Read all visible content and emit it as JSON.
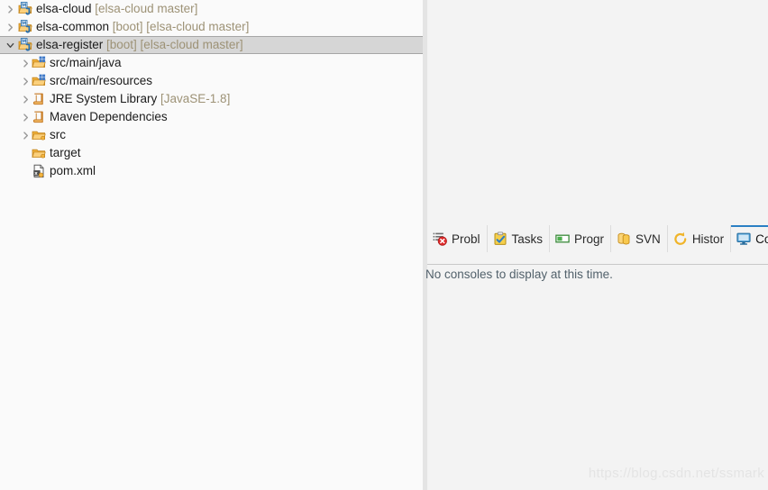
{
  "explorer": {
    "rows": [
      {
        "label": "elsa-cloud",
        "decoration": " [elsa-cloud master]",
        "icon": "maven-project-folder-icon",
        "level": 0,
        "twisty": "collapsed",
        "selected": false,
        "name": "tree-item-elsa-cloud"
      },
      {
        "label": "elsa-common",
        "decoration": " [boot] [elsa-cloud master]",
        "icon": "maven-project-folder-icon",
        "level": 0,
        "twisty": "collapsed",
        "selected": false,
        "name": "tree-item-elsa-common"
      },
      {
        "label": "elsa-register",
        "decoration": " [boot] [elsa-cloud master]",
        "icon": "maven-project-folder-icon",
        "level": 0,
        "twisty": "expanded",
        "selected": true,
        "name": "tree-item-elsa-register"
      },
      {
        "label": "src/main/java",
        "decoration": "",
        "icon": "source-folder-icon",
        "level": 1,
        "twisty": "collapsed",
        "selected": false,
        "name": "tree-item-src-main-java"
      },
      {
        "label": "src/main/resources",
        "decoration": "",
        "icon": "source-folder-icon",
        "level": 1,
        "twisty": "collapsed",
        "selected": false,
        "name": "tree-item-src-main-resources"
      },
      {
        "label": "JRE System Library",
        "decoration": " [JavaSE-1.8]",
        "icon": "library-icon",
        "level": 1,
        "twisty": "collapsed",
        "selected": false,
        "name": "tree-item-jre-system-library"
      },
      {
        "label": "Maven Dependencies",
        "decoration": "",
        "icon": "library-icon",
        "level": 1,
        "twisty": "collapsed",
        "selected": false,
        "name": "tree-item-maven-dependencies"
      },
      {
        "label": "src",
        "decoration": "",
        "icon": "folder-icon",
        "level": 1,
        "twisty": "collapsed",
        "selected": false,
        "name": "tree-item-src"
      },
      {
        "label": "target",
        "decoration": "",
        "icon": "folder-icon",
        "level": 1,
        "twisty": "none",
        "selected": false,
        "name": "tree-item-target"
      },
      {
        "label": "pom.xml",
        "decoration": "",
        "icon": "xml-file-icon",
        "level": 1,
        "twisty": "none",
        "selected": false,
        "name": "tree-item-pom-xml"
      }
    ]
  },
  "console_view": {
    "tabs": [
      {
        "label": "Probl",
        "icon": "problems-icon",
        "active": false,
        "name": "tab-problems"
      },
      {
        "label": "Tasks",
        "icon": "tasks-icon",
        "active": false,
        "name": "tab-tasks"
      },
      {
        "label": "Progr",
        "icon": "progress-icon",
        "active": false,
        "name": "tab-progress"
      },
      {
        "label": "SVN",
        "icon": "svn-icon",
        "active": false,
        "name": "tab-svn"
      },
      {
        "label": "Histor",
        "icon": "history-icon",
        "active": false,
        "name": "tab-history"
      },
      {
        "label": "Cons",
        "icon": "console-icon",
        "active": true,
        "name": "tab-console"
      }
    ],
    "message": "No consoles to display at this time."
  },
  "watermark": "https://blog.csdn.net/ssmark",
  "colors": {
    "selection_background": "#d6d6d6",
    "decoration_text": "#9d9276",
    "active_tab_underline": "#2b7fc4",
    "console_message_text": "#52616b",
    "panel_background": "#f3f3f3",
    "tree_background": "#fafafa"
  }
}
